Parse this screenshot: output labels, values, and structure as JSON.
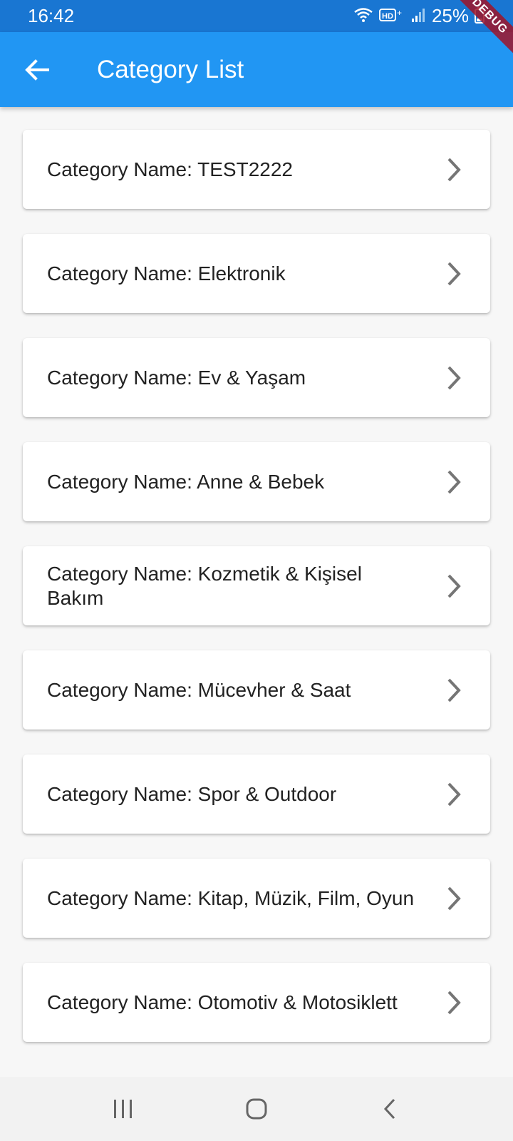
{
  "status_bar": {
    "time": "16:42",
    "icons": [
      "wifi-icon",
      "hd-volte-icon",
      "signal-icon",
      "battery-icon"
    ],
    "battery": "25%"
  },
  "debug_banner": "DEBUG",
  "app_bar": {
    "back_icon": "arrow-left-icon",
    "title": "Category List",
    "color": "#2196f3"
  },
  "categories": [
    {
      "label": "Category Name: TEST2222"
    },
    {
      "label": "Category Name: Elektronik"
    },
    {
      "label": "Category Name: Ev & Yaşam"
    },
    {
      "label": "Category Name: Anne & Bebek"
    },
    {
      "label": "Category Name: Kozmetik & Kişisel Bakım"
    },
    {
      "label": "Category Name: Mücevher & Saat"
    },
    {
      "label": "Category Name: Spor & Outdoor"
    },
    {
      "label": "Category Name: Kitap, Müzik, Film, Oyun"
    },
    {
      "label": "Category Name: Otomotiv & Motosiklett"
    }
  ],
  "nav_bar": {
    "icons": [
      "recent-apps-icon",
      "home-icon",
      "back-icon"
    ]
  }
}
